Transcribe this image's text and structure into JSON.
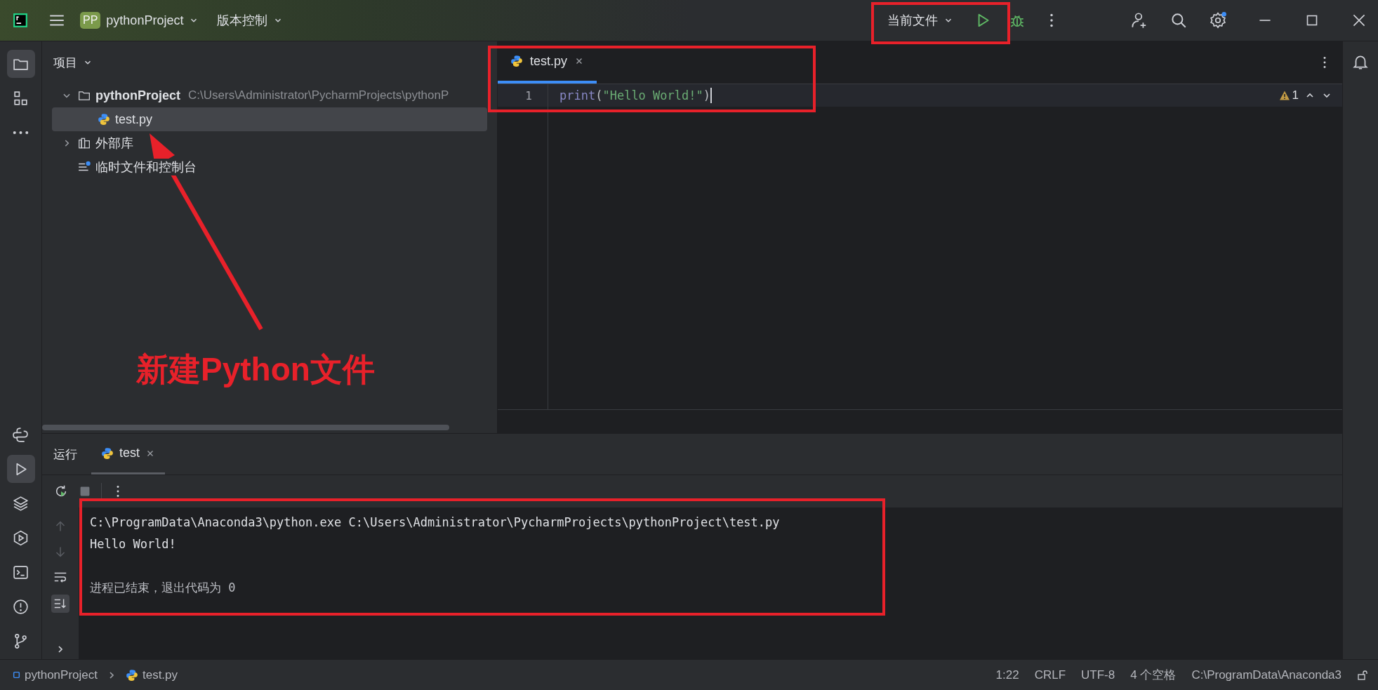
{
  "title_bar": {
    "project_badge": "PP",
    "project_name": "pythonProject",
    "vcs_menu": "版本控制",
    "run_config": "当前文件"
  },
  "tool_strip": {
    "top": [
      {
        "kind": "folder",
        "selected": true
      },
      {
        "kind": "structure",
        "selected": false
      },
      {
        "kind": "more",
        "selected": false
      }
    ],
    "bottom": [
      {
        "kind": "python",
        "selected": false
      },
      {
        "kind": "run",
        "selected": true
      },
      {
        "kind": "layers",
        "selected": false
      },
      {
        "kind": "services",
        "selected": false
      },
      {
        "kind": "terminal",
        "selected": false
      },
      {
        "kind": "problems",
        "selected": false
      },
      {
        "kind": "git",
        "selected": false
      }
    ]
  },
  "project_panel": {
    "title": "项目",
    "tree": [
      {
        "label": "pythonProject",
        "path": "C:\\Users\\Administrator\\PycharmProjects\\pythonP",
        "kind": "folder",
        "expanded": true,
        "selected": false,
        "children": [
          {
            "label": "test.py",
            "kind": "python",
            "selected": true
          }
        ]
      },
      {
        "label": "外部库",
        "kind": "library",
        "expanded": false,
        "selected": false
      },
      {
        "label": "临时文件和控制台",
        "kind": "scratch",
        "selected": false
      }
    ]
  },
  "editor": {
    "tabs": [
      {
        "label": "test.py",
        "selected": true
      }
    ],
    "warning_count": "1",
    "lines": [
      {
        "number": "1",
        "tokens": [
          {
            "text": "print",
            "kind": "builtin"
          },
          {
            "text": "(",
            "kind": "paren"
          },
          {
            "text": "\"Hello World!\"",
            "kind": "string"
          },
          {
            "text": ")",
            "kind": "paren"
          }
        ]
      }
    ]
  },
  "run_panel": {
    "title": "运行",
    "tabs": [
      {
        "label": "test",
        "selected": true
      }
    ],
    "output": [
      "C:\\ProgramData\\Anaconda3\\python.exe C:\\Users\\Administrator\\PycharmProjects\\pythonProject\\test.py",
      "Hello World!"
    ],
    "exit_message": "进程已结束，退出代码为 0"
  },
  "status_bar": {
    "breadcrumbs": [
      {
        "label": "pythonProject",
        "kind": "module"
      },
      {
        "label": "test.py",
        "kind": "python"
      }
    ],
    "items": [
      "1:22",
      "CRLF",
      "UTF-8",
      "4 个空格",
      "C:\\ProgramData\\Anaconda3"
    ]
  },
  "annotation": {
    "caption": "新建Python文件"
  }
}
